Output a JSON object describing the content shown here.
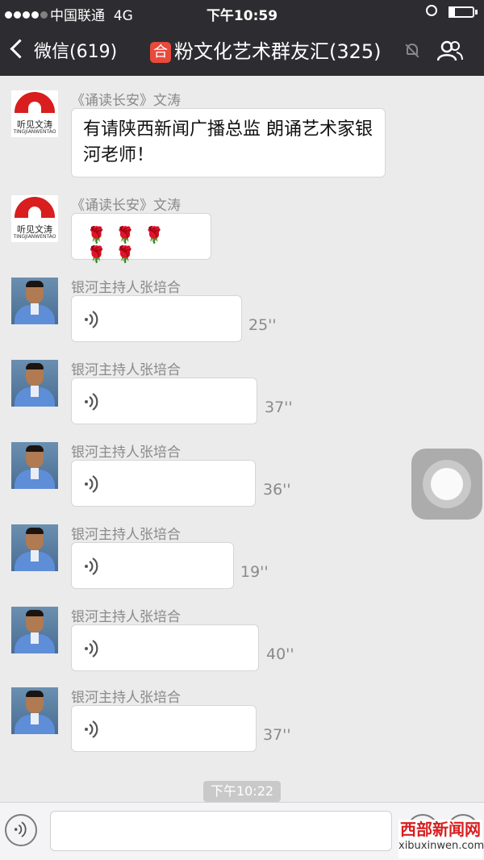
{
  "status_bar": {
    "carrier": "中国联通",
    "network": "4G",
    "time": "下午10:59"
  },
  "nav": {
    "back_label": "微信(619)",
    "title_badge": "合",
    "title": "粉文化艺术群友汇(325)"
  },
  "messages": [
    {
      "sender": "《诵读长安》文涛",
      "avatar": "fan-logo",
      "logo_text": "听见文涛",
      "logo_sub": "TINGJIANWENTAO",
      "type": "text",
      "text": "有请陕西新闻广播总监  朗诵艺术家银河老师！"
    },
    {
      "sender": "《诵读长安》文涛",
      "avatar": "fan-logo",
      "logo_text": "听见文涛",
      "logo_sub": "TINGJIANWENTAO",
      "type": "text",
      "text": "🌹🌹🌹🌹🌹"
    },
    {
      "sender": "银河主持人张培合",
      "type": "voice",
      "duration": "25''"
    },
    {
      "sender": "银河主持人张培合",
      "type": "voice",
      "duration": "37''"
    },
    {
      "sender": "银河主持人张培合",
      "type": "voice",
      "duration": "36''"
    },
    {
      "sender": "银河主持人张培合",
      "type": "voice",
      "duration": "19''"
    },
    {
      "sender": "银河主持人张培合",
      "type": "voice",
      "duration": "40''"
    },
    {
      "sender": "银河主持人张培合",
      "type": "voice",
      "duration": "37''"
    }
  ],
  "timestamp": "下午10:22",
  "input": {
    "placeholder": ""
  },
  "watermark": {
    "line1": "西部新闻网",
    "line2": "xibuxinwen.com"
  },
  "colors": {
    "nav_bg": "#2d2d31",
    "chat_bg": "#ebebeb",
    "rose": "#c8102e"
  }
}
